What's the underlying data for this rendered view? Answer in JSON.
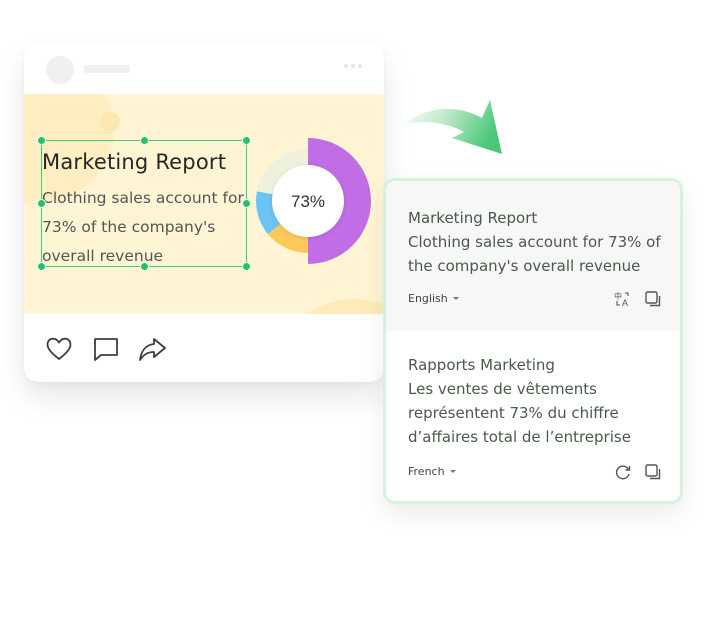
{
  "post": {
    "image_text": {
      "title": "Marketing Report",
      "body": "Clothing sales account for 73% of the company's overall revenue"
    },
    "donut": {
      "center_label": "73%",
      "segments": [
        {
          "name": "clothing",
          "value": 50,
          "color": "#c06de6"
        },
        {
          "name": "segment-yellow",
          "value": 14,
          "color": "#fdc95a"
        },
        {
          "name": "segment-blue",
          "value": 14,
          "color": "#6cc4f4"
        },
        {
          "name": "segment-track",
          "value": 22,
          "color": "#eef2dc"
        }
      ]
    },
    "actions": [
      {
        "icon": "heart-icon"
      },
      {
        "icon": "comment-icon"
      },
      {
        "icon": "share-icon"
      }
    ]
  },
  "translation": {
    "source": {
      "text_title": "Marketing Report",
      "text_body": "Clothing sales account for 73% of the company's overall revenue",
      "language": "English",
      "icons": [
        "translate-icon",
        "copy-icon"
      ]
    },
    "target": {
      "text_title": "Rapports Marketing",
      "text_body": "Les ventes de vêtements représentent 73% du chiffre d’affaires total de l’entreprise",
      "language": "French",
      "icons": [
        "refresh-icon",
        "copy-icon"
      ]
    }
  },
  "colors": {
    "accent_green": "#22c36a",
    "panel_border": "#d5f3dc",
    "image_bg": "#fff5d4"
  }
}
